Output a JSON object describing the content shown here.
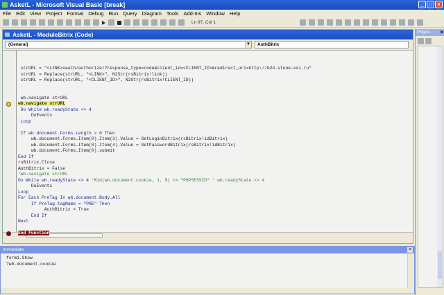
{
  "window": {
    "title": "AsketL - Microsoft Visual Basic [break]"
  },
  "menu": [
    "File",
    "Edit",
    "View",
    "Project",
    "Format",
    "Debug",
    "Run",
    "Query",
    "Diagram",
    "Tools",
    "Add-Ins",
    "Window",
    "Help"
  ],
  "toolbar": {
    "position": "Ln 97, Col 1"
  },
  "code_window": {
    "title": "AsketL - ModuleBitrix (Code)",
    "object_combo": "(General)",
    "procedure_combo": "AuthBitrix",
    "lines": [
      {
        "text": " strURL = \"<LINK>oauth/authorize/?response_type=code&client_id=<CLIENT_ID>&redirect_uri=http://b24.stone-xxi.ru\"",
        "style": "",
        "row": 0
      },
      {
        "text": " strURL = Replace(strURL, \"<LINK>\", N2Str(rsBitrix!link))",
        "style": "",
        "row": 1
      },
      {
        "text": " strURL = Replace(strURL, \"<CLIENT_ID>\", N2Str(rsBitrix!CLIENT_ID))",
        "style": "",
        "row": 2
      },
      {
        "text": " wb.navigate strURL",
        "style": "",
        "row": 5
      },
      {
        "text": "wb.navigate strURL",
        "style": "hl",
        "row": 6
      },
      {
        "text": " Do While wb.readyState <> 4",
        "style": "kw",
        "row": 7
      },
      {
        "text": "     DoEvents",
        "style": "",
        "row": 8
      },
      {
        "text": " Loop",
        "style": "kw",
        "row": 9
      },
      {
        "text": " If wb.document.Forms.Length > 0 Then",
        "style": "kw",
        "row": 11
      },
      {
        "text": "     wb.document.Forms.Item(0).Item(3).Value = GetLoginBitrix(rsBitrix!idBitrix)",
        "style": "",
        "row": 12
      },
      {
        "text": "     wb.document.Forms.Item(0).Item(4).Value = GetPasswordBitrix(rsBitrix!idBitrix)",
        "style": "",
        "row": 13
      },
      {
        "text": "     wb.document.Forms.Item(0).submit",
        "style": "",
        "row": 14
      },
      {
        "text": "End If",
        "style": "kw",
        "row": 15
      },
      {
        "text": "rsBitrix.Close",
        "style": "",
        "row": 16
      },
      {
        "text": "AuthBitrix = False",
        "style": "",
        "row": 17
      },
      {
        "text": "'wb.navigate strURL",
        "style": "cm",
        "row": 18
      },
      {
        "text": "Do While wb.readyState <> 4 ",
        "style": "kw",
        "row": 19,
        "comment": "'Mid(wb.document.cookie, 1, 9) <> \"PHPSESSID\" ' wb.readyState <> 4"
      },
      {
        "text": "     DoEvents",
        "style": "",
        "row": 20
      },
      {
        "text": "Loop",
        "style": "kw",
        "row": 21
      },
      {
        "text": "For Each PreTag In wb.document.Body.All",
        "style": "kw",
        "row": 22
      },
      {
        "text": "     If PreTag.tagName = \"PRE\" Then",
        "style": "kw",
        "row": 23
      },
      {
        "text": "          AuthBitrix = True",
        "style": "",
        "row": 24
      },
      {
        "text": "     End If",
        "style": "kw",
        "row": 25
      },
      {
        "text": "Next",
        "style": "kw",
        "row": 26
      },
      {
        "text": "End Function",
        "style": "bp",
        "row": 28
      }
    ]
  },
  "immediate": {
    "title": "Immediate",
    "lines": [
      "form1.Show",
      "?wb.document.cookie"
    ]
  },
  "project_panel": {
    "title": "Project - "
  }
}
